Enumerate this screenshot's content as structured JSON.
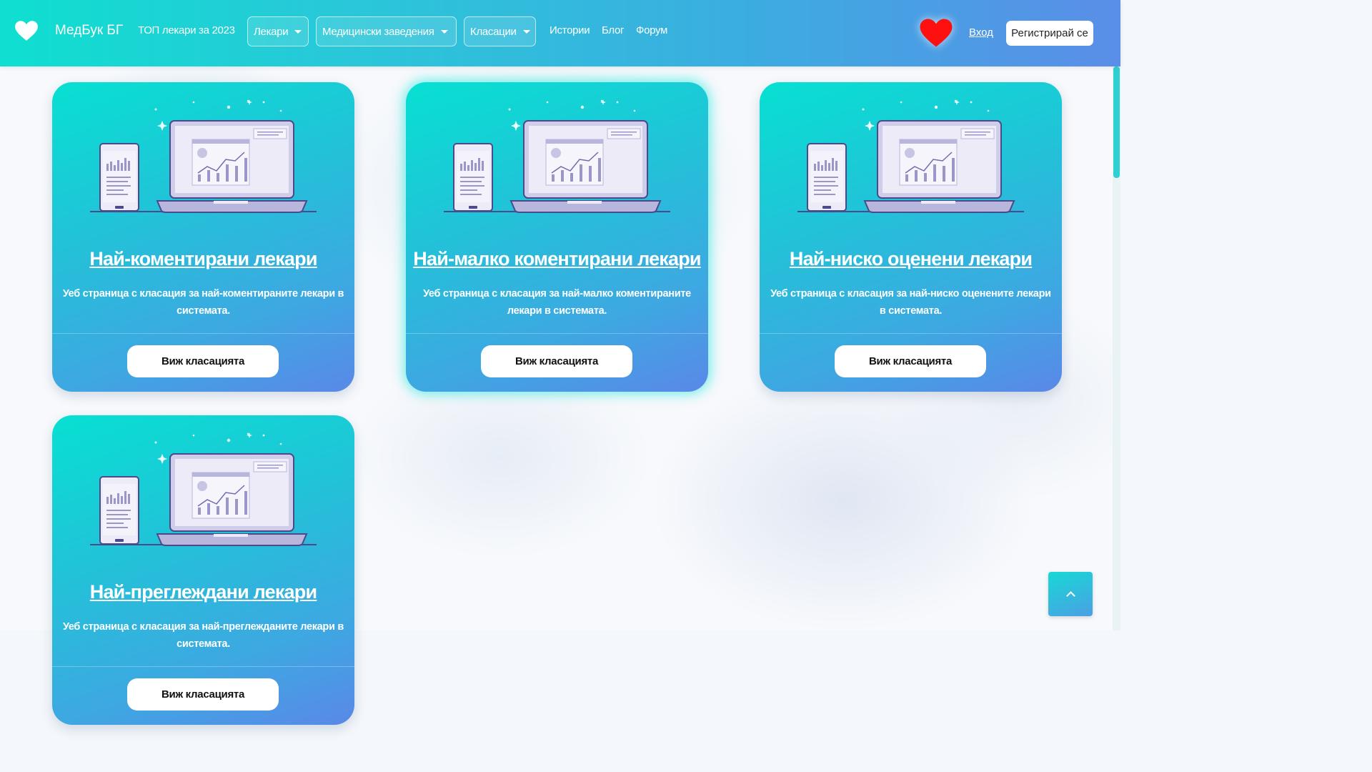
{
  "navbar": {
    "brand_name": "МедБук БГ",
    "top_doctors": "ТОП лекари за 2023",
    "dropdown_doctors": "Лекари",
    "dropdown_facilities": "Медицински заведения",
    "dropdown_rankings": "Класации",
    "stories": "Истории",
    "blog": "Блог",
    "forum": "Форум",
    "login": "Вход",
    "register": "Регистрирай се",
    "heart_color": "#ff1010"
  },
  "cards": [
    {
      "title": "Най-коментирани лекари",
      "description": "Уеб страница с класация за най-коментираните лекари в системата.",
      "button": "Виж класацията"
    },
    {
      "title": "Най-малко коментирани лекари",
      "description": "Уеб страница с класация за най-малко коментираните лекари в системата.",
      "button": "Виж класацията"
    },
    {
      "title": "Най-ниско оценени лекари",
      "description": "Уеб страница с класация за най-ниско оценените лекари в системата.",
      "button": "Виж класацията"
    },
    {
      "title": "Най-преглеждани лекари",
      "description": "Уеб страница с класация за най-преглежданите лекари в системата.",
      "button": "Виж класацията"
    }
  ],
  "colors": {
    "accent_teal": "#07e0d2",
    "accent_blue": "#5a88e8"
  }
}
